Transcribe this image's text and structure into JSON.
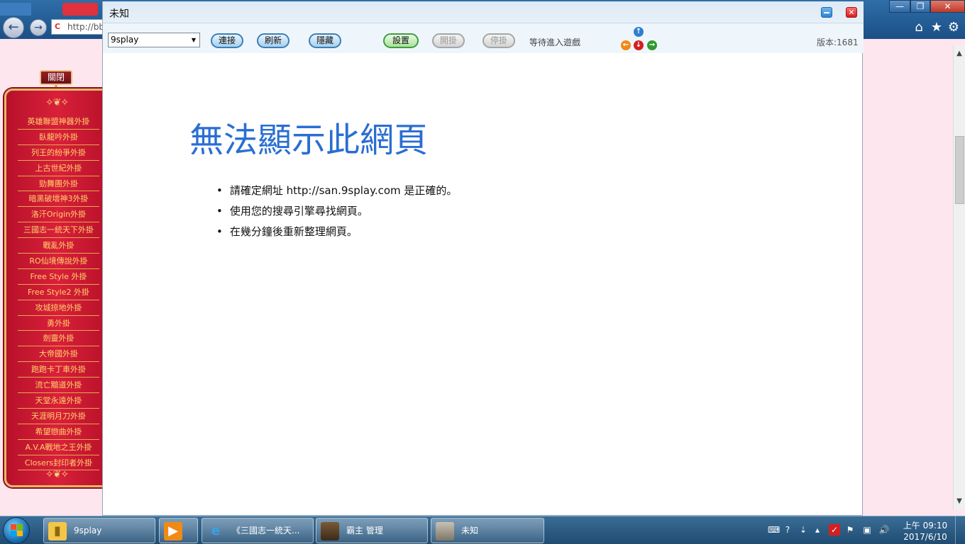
{
  "browser": {
    "address_text": "http://bb",
    "back_icon": "back-arrow-icon",
    "forward_icon": "forward-arrow-icon",
    "window_buttons": {
      "minimize": "—",
      "maximize": "❐",
      "close": "✕"
    }
  },
  "sidebar": {
    "close_label": "關閉",
    "items": [
      {
        "label": "英雄聯盟神器外掛"
      },
      {
        "label": "臥龍吟外掛"
      },
      {
        "label": "列王的紛爭外掛"
      },
      {
        "label": "上古世紀外掛"
      },
      {
        "label": "勁舞團外掛"
      },
      {
        "label": "暗黑破壞神3外掛"
      },
      {
        "label": "洛汗Origin外掛"
      },
      {
        "label": "三國志一統天下外掛"
      },
      {
        "label": "戰亂外掛"
      },
      {
        "label": "RO仙境傳說外掛"
      },
      {
        "label": "Free Style 外掛"
      },
      {
        "label": "Free Style2 外掛"
      },
      {
        "label": "攻城掠地外掛"
      },
      {
        "label": "勇外掛"
      },
      {
        "label": "劍靈外掛"
      },
      {
        "label": "大帝國外掛"
      },
      {
        "label": "跑跑卡丁車外掛"
      },
      {
        "label": "流亡黯道外掛"
      },
      {
        "label": "天堂永遠外掛"
      },
      {
        "label": "天涯明月刀外掛"
      },
      {
        "label": "希望戀曲外掛"
      },
      {
        "label": "A.V.A戰地之王外掛"
      },
      {
        "label": "Closers封印者外掛"
      }
    ]
  },
  "app": {
    "title": "未知",
    "toolbar": {
      "server_select": {
        "value": "9splay"
      },
      "connect_label": "連接",
      "refresh_label": "刷新",
      "hide_label": "隱藏",
      "settings_label": "設置",
      "start_label": "開掛",
      "stop_label": "停掛",
      "status": "等待進入遊戲",
      "direction_up": "↑",
      "direction_left": "←",
      "direction_down": "↓",
      "direction_right": "→",
      "version": "版本:1681"
    },
    "error_page": {
      "title": "無法顯示此網頁",
      "bullets": [
        "請確定網址 http://san.9splay.com 是正確的。",
        "使用您的搜尋引擎尋找網頁。",
        "在幾分鐘後重新整理網頁。"
      ]
    }
  },
  "taskbar": {
    "tasks": [
      {
        "label": "9splay",
        "icon": "folder-icon"
      },
      {
        "label": "",
        "icon": "media-player-icon"
      },
      {
        "label": "《三國志一統天...",
        "icon": "internet-explorer-icon"
      },
      {
        "label": "霸主 管理",
        "icon": "game-thumbnail-icon"
      },
      {
        "label": "未知",
        "icon": "game-thumbnail-icon"
      }
    ],
    "clock": {
      "time": "上午 09:10",
      "date": "2017/6/10"
    }
  },
  "colors": {
    "error_title": "#2a6ed3",
    "sidebar_red": "#c8152f",
    "sidebar_gold": "#ffd36b",
    "taskbar": "#2b5a82"
  }
}
